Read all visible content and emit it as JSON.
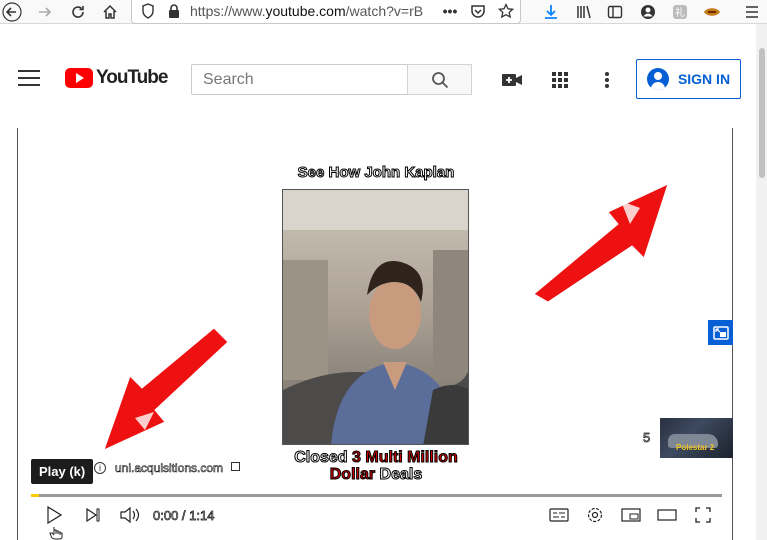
{
  "browser": {
    "url_scheme": "https://www.",
    "url_host": "youtube.com",
    "url_path": "/watch?v=rB",
    "icons": [
      "back-icon",
      "forward-icon",
      "reload-icon",
      "home-icon",
      "shield-icon",
      "lock-icon",
      "more-icon",
      "pocket-icon",
      "bookmark-star-icon",
      "download-icon",
      "library-icon",
      "sidebar-icon",
      "account-icon",
      "extension-icon",
      "extension-icon-2",
      "menu-icon"
    ]
  },
  "header": {
    "logo_text": "YouTube",
    "search_placeholder": "Search",
    "signin_label": "SIGN IN",
    "icons": [
      "hamburger-icon",
      "search-icon",
      "create-video-icon",
      "apps-grid-icon",
      "more-vert-icon",
      "account-circle-icon"
    ]
  },
  "player": {
    "ad_title": "See How John Kaplan",
    "ad_caption_1": "Closed ",
    "ad_caption_red": "3 Multi Million",
    "ad_caption_2_red": "Dollar",
    "ad_caption_3": " Deals",
    "tooltip": "Play (k)",
    "ad_url": "uni.acquisitions.com",
    "skip_countdown": "5",
    "next_thumb_text": "Polestar 2",
    "time": "0:00 / 1:14",
    "progress_fraction": 0.012,
    "accent_color": "#065fd4",
    "progress_color": "#ffcc00"
  }
}
